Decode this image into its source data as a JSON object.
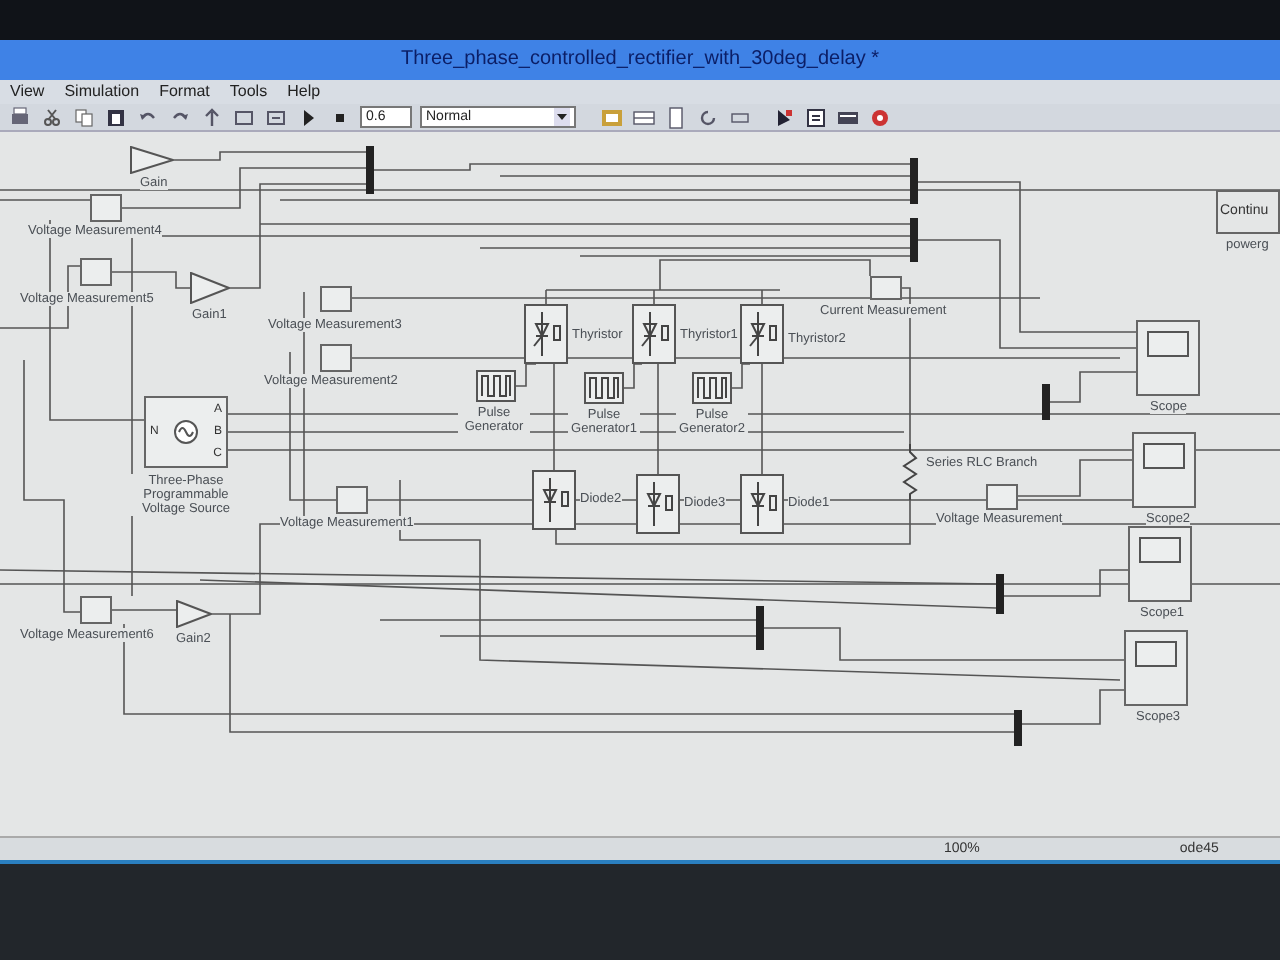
{
  "window": {
    "title": "Three_phase_controlled_rectifier_with_30deg_delay *"
  },
  "menu": [
    "View",
    "Simulation",
    "Format",
    "Tools",
    "Help"
  ],
  "toolbar": {
    "stop_time": "0.6",
    "mode": "Normal"
  },
  "blocks": [
    {
      "kind": "gain",
      "label": "Gain"
    },
    {
      "kind": "meter",
      "label": "Voltage Measurement4"
    },
    {
      "kind": "powergui",
      "label": "powerg",
      "text": "Continu"
    },
    {
      "kind": "meter",
      "label": "Voltage Measurement5"
    },
    {
      "kind": "gain",
      "label": "Gain1"
    },
    {
      "kind": "meter",
      "label": "Voltage Measurement3"
    },
    {
      "kind": "meter",
      "label": "Voltage Measurement2"
    },
    {
      "kind": "source",
      "label": "Three-Phase Programmable Voltage Source",
      "ports": [
        "N",
        "A",
        "B",
        "C"
      ]
    },
    {
      "kind": "meter",
      "label": "Voltage Measurement1"
    },
    {
      "kind": "thyristor",
      "label": "Thyristor"
    },
    {
      "kind": "thyristor",
      "label": "Thyristor1"
    },
    {
      "kind": "thyristor",
      "label": "Thyristor2"
    },
    {
      "kind": "meter",
      "label": "Current Measurement"
    },
    {
      "kind": "pulse",
      "label": "Pulse Generator"
    },
    {
      "kind": "pulse",
      "label": "Pulse Generator1"
    },
    {
      "kind": "pulse",
      "label": "Pulse Generator2"
    },
    {
      "kind": "diode",
      "label": "Diode2"
    },
    {
      "kind": "diode",
      "label": "Diode3"
    },
    {
      "kind": "diode",
      "label": "Diode1"
    },
    {
      "kind": "rlc",
      "label": "Series RLC Branch"
    },
    {
      "kind": "meter",
      "label": "Voltage Measurement"
    },
    {
      "kind": "scope",
      "label": "Scope"
    },
    {
      "kind": "scope",
      "label": "Scope2"
    },
    {
      "kind": "scope",
      "label": "Scope1"
    },
    {
      "kind": "meter",
      "label": "Voltage Measurement6"
    },
    {
      "kind": "gain",
      "label": "Gain2"
    },
    {
      "kind": "scope",
      "label": "Scope3"
    }
  ],
  "status_bar": {
    "zoom": "100%",
    "solver": "ode45"
  }
}
